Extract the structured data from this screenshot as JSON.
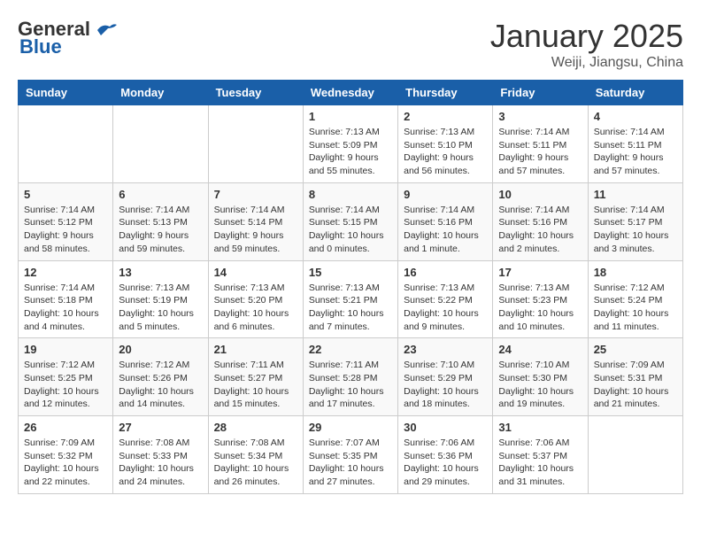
{
  "header": {
    "logo_general": "General",
    "logo_blue": "Blue",
    "month_title": "January 2025",
    "location": "Weiji, Jiangsu, China"
  },
  "weekdays": [
    "Sunday",
    "Monday",
    "Tuesday",
    "Wednesday",
    "Thursday",
    "Friday",
    "Saturday"
  ],
  "weeks": [
    [
      {
        "day": "",
        "info": ""
      },
      {
        "day": "",
        "info": ""
      },
      {
        "day": "",
        "info": ""
      },
      {
        "day": "1",
        "info": "Sunrise: 7:13 AM\nSunset: 5:09 PM\nDaylight: 9 hours and 55 minutes."
      },
      {
        "day": "2",
        "info": "Sunrise: 7:13 AM\nSunset: 5:10 PM\nDaylight: 9 hours and 56 minutes."
      },
      {
        "day": "3",
        "info": "Sunrise: 7:14 AM\nSunset: 5:11 PM\nDaylight: 9 hours and 57 minutes."
      },
      {
        "day": "4",
        "info": "Sunrise: 7:14 AM\nSunset: 5:11 PM\nDaylight: 9 hours and 57 minutes."
      }
    ],
    [
      {
        "day": "5",
        "info": "Sunrise: 7:14 AM\nSunset: 5:12 PM\nDaylight: 9 hours and 58 minutes."
      },
      {
        "day": "6",
        "info": "Sunrise: 7:14 AM\nSunset: 5:13 PM\nDaylight: 9 hours and 59 minutes."
      },
      {
        "day": "7",
        "info": "Sunrise: 7:14 AM\nSunset: 5:14 PM\nDaylight: 9 hours and 59 minutes."
      },
      {
        "day": "8",
        "info": "Sunrise: 7:14 AM\nSunset: 5:15 PM\nDaylight: 10 hours and 0 minutes."
      },
      {
        "day": "9",
        "info": "Sunrise: 7:14 AM\nSunset: 5:16 PM\nDaylight: 10 hours and 1 minute."
      },
      {
        "day": "10",
        "info": "Sunrise: 7:14 AM\nSunset: 5:16 PM\nDaylight: 10 hours and 2 minutes."
      },
      {
        "day": "11",
        "info": "Sunrise: 7:14 AM\nSunset: 5:17 PM\nDaylight: 10 hours and 3 minutes."
      }
    ],
    [
      {
        "day": "12",
        "info": "Sunrise: 7:14 AM\nSunset: 5:18 PM\nDaylight: 10 hours and 4 minutes."
      },
      {
        "day": "13",
        "info": "Sunrise: 7:13 AM\nSunset: 5:19 PM\nDaylight: 10 hours and 5 minutes."
      },
      {
        "day": "14",
        "info": "Sunrise: 7:13 AM\nSunset: 5:20 PM\nDaylight: 10 hours and 6 minutes."
      },
      {
        "day": "15",
        "info": "Sunrise: 7:13 AM\nSunset: 5:21 PM\nDaylight: 10 hours and 7 minutes."
      },
      {
        "day": "16",
        "info": "Sunrise: 7:13 AM\nSunset: 5:22 PM\nDaylight: 10 hours and 9 minutes."
      },
      {
        "day": "17",
        "info": "Sunrise: 7:13 AM\nSunset: 5:23 PM\nDaylight: 10 hours and 10 minutes."
      },
      {
        "day": "18",
        "info": "Sunrise: 7:12 AM\nSunset: 5:24 PM\nDaylight: 10 hours and 11 minutes."
      }
    ],
    [
      {
        "day": "19",
        "info": "Sunrise: 7:12 AM\nSunset: 5:25 PM\nDaylight: 10 hours and 12 minutes."
      },
      {
        "day": "20",
        "info": "Sunrise: 7:12 AM\nSunset: 5:26 PM\nDaylight: 10 hours and 14 minutes."
      },
      {
        "day": "21",
        "info": "Sunrise: 7:11 AM\nSunset: 5:27 PM\nDaylight: 10 hours and 15 minutes."
      },
      {
        "day": "22",
        "info": "Sunrise: 7:11 AM\nSunset: 5:28 PM\nDaylight: 10 hours and 17 minutes."
      },
      {
        "day": "23",
        "info": "Sunrise: 7:10 AM\nSunset: 5:29 PM\nDaylight: 10 hours and 18 minutes."
      },
      {
        "day": "24",
        "info": "Sunrise: 7:10 AM\nSunset: 5:30 PM\nDaylight: 10 hours and 19 minutes."
      },
      {
        "day": "25",
        "info": "Sunrise: 7:09 AM\nSunset: 5:31 PM\nDaylight: 10 hours and 21 minutes."
      }
    ],
    [
      {
        "day": "26",
        "info": "Sunrise: 7:09 AM\nSunset: 5:32 PM\nDaylight: 10 hours and 22 minutes."
      },
      {
        "day": "27",
        "info": "Sunrise: 7:08 AM\nSunset: 5:33 PM\nDaylight: 10 hours and 24 minutes."
      },
      {
        "day": "28",
        "info": "Sunrise: 7:08 AM\nSunset: 5:34 PM\nDaylight: 10 hours and 26 minutes."
      },
      {
        "day": "29",
        "info": "Sunrise: 7:07 AM\nSunset: 5:35 PM\nDaylight: 10 hours and 27 minutes."
      },
      {
        "day": "30",
        "info": "Sunrise: 7:06 AM\nSunset: 5:36 PM\nDaylight: 10 hours and 29 minutes."
      },
      {
        "day": "31",
        "info": "Sunrise: 7:06 AM\nSunset: 5:37 PM\nDaylight: 10 hours and 31 minutes."
      },
      {
        "day": "",
        "info": ""
      }
    ]
  ]
}
